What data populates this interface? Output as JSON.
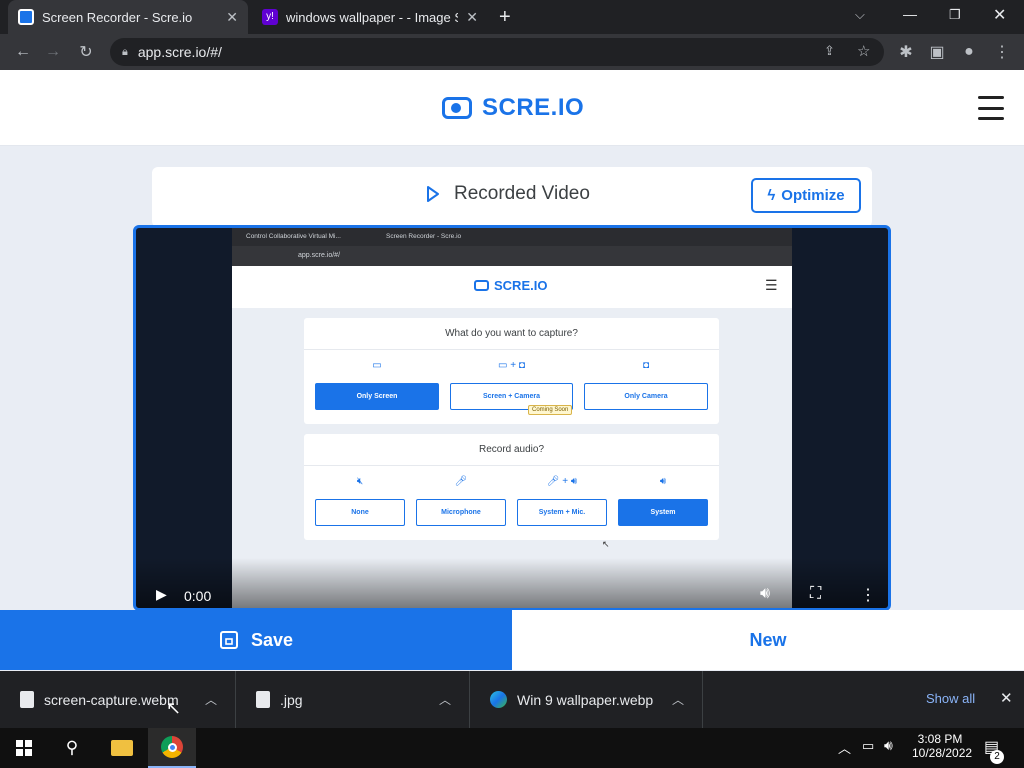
{
  "browser": {
    "tabs": [
      {
        "title": "Screen Recorder - Scre.io",
        "active": true
      },
      {
        "title": "windows wallpaper - - Image Sea",
        "active": false
      }
    ],
    "new_tab_label": "+",
    "url": "app.scre.io/#/"
  },
  "site": {
    "logo_text": "SCRE.IO",
    "card_title": "Recorded Video",
    "optimize_label": "Optimize"
  },
  "video": {
    "time": "0:00",
    "inner": {
      "tab1": "Control Collaborative Virtual Mi...",
      "tab2": "Screen Recorder - Scre.io",
      "url": "app.scre.io/#/",
      "logo_text": "SCRE.IO",
      "capture_question": "What do you want to capture?",
      "capture_options": [
        "Only Screen",
        "Screen + Camera",
        "Only Camera"
      ],
      "coming_soon": "Coming Soon",
      "audio_question": "Record audio?",
      "audio_options": [
        "None",
        "Microphone",
        "System + Mic.",
        "System"
      ]
    }
  },
  "actions": {
    "save_label": "Save",
    "new_label": "New"
  },
  "downloads": {
    "items": [
      {
        "name": "screen-capture.webm"
      },
      {
        "name": ".jpg"
      },
      {
        "name": "Win 9 wallpaper.webp"
      }
    ],
    "show_all": "Show all"
  },
  "taskbar": {
    "time": "3:08 PM",
    "date": "10/28/2022",
    "notification_count": "2"
  },
  "colors": {
    "accent": "#1a73e8",
    "browser_dark": "#202124"
  }
}
